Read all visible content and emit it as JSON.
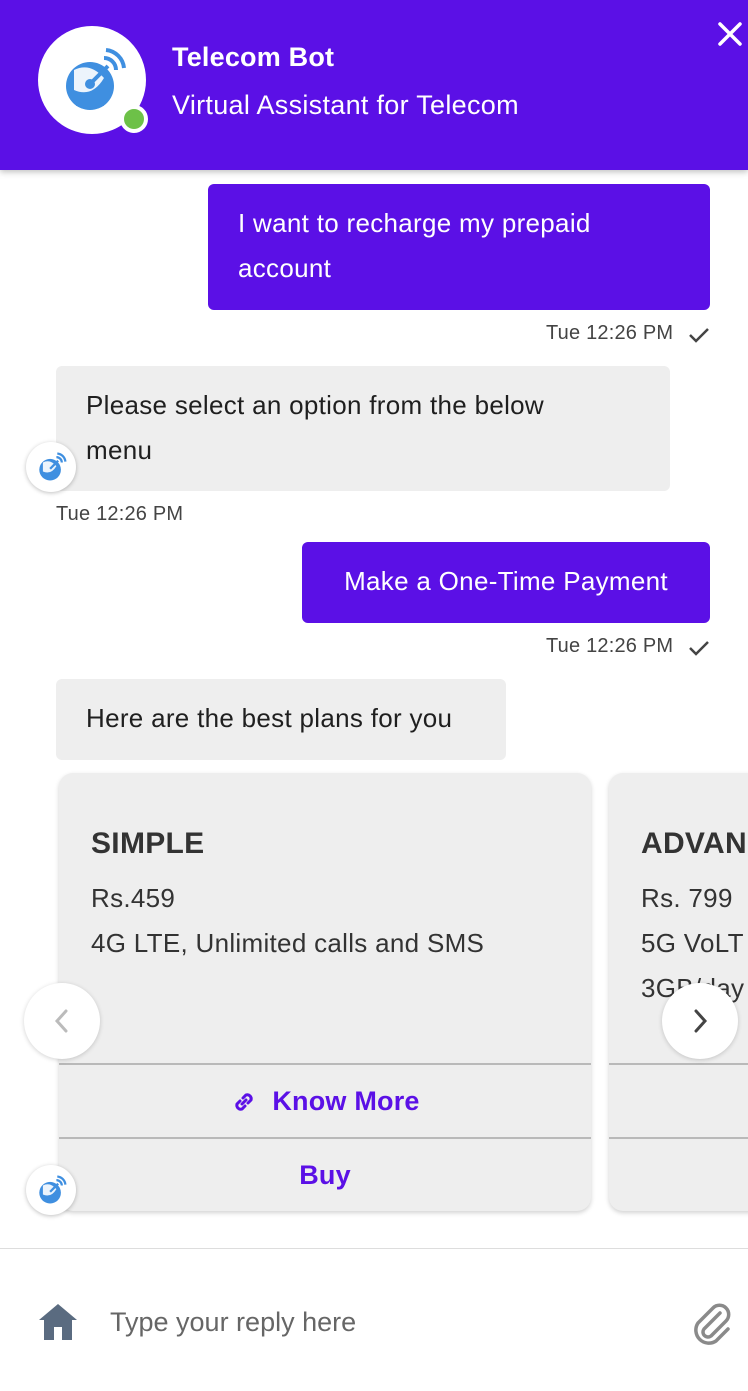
{
  "header": {
    "bot_name": "Telecom Bot",
    "bot_subtitle": "Virtual Assistant for Telecom",
    "status": "online",
    "close_icon": "close-icon",
    "brand_color": "#5b10e6",
    "online_color": "#6dc148"
  },
  "messages": [
    {
      "from": "user",
      "text": "I want to recharge my prepaid account",
      "line1": "I want to recharge my prepaid",
      "line2": "account",
      "time": "Tue 12:26 PM",
      "read_icon": "check-icon"
    },
    {
      "from": "bot",
      "text": "Please select an option from the below menu",
      "line1": "Please select an option from the below",
      "line2": "menu",
      "time": "Tue 12:26 PM"
    },
    {
      "from": "user",
      "text": "Make a One-Time Payment",
      "time": "Tue 12:26 PM",
      "read_icon": "check-icon"
    },
    {
      "from": "bot",
      "text": "Here are the best plans for you"
    }
  ],
  "carousel": {
    "cards": [
      {
        "title": "SIMPLE",
        "price": "Rs.459",
        "desc": "4G LTE, Unlimited calls and SMS",
        "know_more": "Know More",
        "buy": "Buy"
      },
      {
        "title": "ADVAN",
        "price": "Rs. 799",
        "desc": "5G VoLT",
        "desc2": "3GB/day"
      }
    ],
    "prev_icon": "chevron-left-icon",
    "next_icon": "chevron-right-icon"
  },
  "composer": {
    "placeholder": "Type your reply here",
    "home_icon": "home-icon",
    "attach_icon": "paperclip-icon"
  }
}
